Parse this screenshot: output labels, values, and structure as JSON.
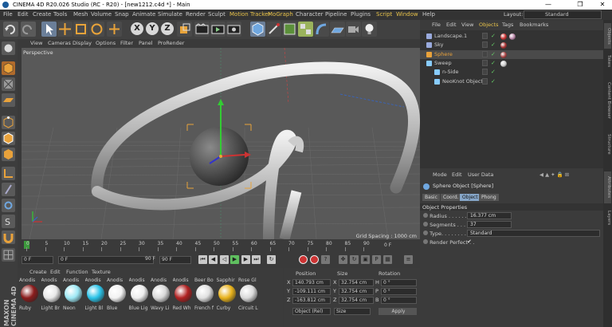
{
  "window": {
    "title": "CINEMA 4D R20.026 Studio (RC - R20) - [new1212.c4d *] - Main",
    "minimize": "—",
    "maximize": "❐",
    "close": "✕"
  },
  "menubar": {
    "items": [
      "File",
      "Edit",
      "Create",
      "Tools",
      "Mesh",
      "Volume",
      "Snap",
      "Animate",
      "Simulate",
      "Render",
      "Sculpt",
      "Motion Tracker",
      "MoGraph",
      "Character",
      "Pipeline",
      "Plugins",
      "Script",
      "Window",
      "Help"
    ],
    "highlighted": [
      "Motion Tracker",
      "Script"
    ],
    "layout_label": "Layout:",
    "layout_value": "Standard"
  },
  "toolbar": {
    "axes": [
      "X",
      "Y",
      "Z"
    ]
  },
  "viewport": {
    "menu": [
      "View",
      "Cameras",
      "Display",
      "Options",
      "Filter",
      "Panel",
      "ProRender"
    ],
    "camera_label": "Perspective",
    "grid_spacing": "Grid Spacing : 1000 cm"
  },
  "timeline": {
    "ticks": [
      "0",
      "5",
      "10",
      "15",
      "20",
      "25",
      "30",
      "35",
      "40",
      "45",
      "50",
      "55",
      "60",
      "65",
      "70",
      "75",
      "80",
      "85",
      "90"
    ],
    "end_frame": "0 F"
  },
  "transport": {
    "start_field": "0 F",
    "current_field": "0 F",
    "end_field": "90 F",
    "max_field": "90 F"
  },
  "materials": {
    "menu": [
      "Create",
      "Edit",
      "Function",
      "Texture"
    ],
    "items": [
      {
        "top": "Anodis",
        "name": "Ruby",
        "color": "#8a1c1c"
      },
      {
        "top": "Anodis",
        "name": "Light Br",
        "color": "#e8e8e8"
      },
      {
        "top": "Anodis",
        "name": "Neon",
        "color": "#9de8f5"
      },
      {
        "top": "Anodis",
        "name": "Light Bl",
        "color": "#2bc3e8"
      },
      {
        "top": "Anodis",
        "name": "Blue",
        "color": "#f2f2f2"
      },
      {
        "top": "Anodis",
        "name": "Blue Lig",
        "color": "#ededed"
      },
      {
        "top": "Anodis",
        "name": "Wavy Li",
        "color": "#d9d9d9"
      },
      {
        "top": "Anodis",
        "name": "Red Wh",
        "color": "#b02222"
      },
      {
        "top": "Beer Bo",
        "name": "French f",
        "color": "#e0e0e0"
      },
      {
        "top": "Sapphir",
        "name": "Curby",
        "color": "#e8b21b"
      },
      {
        "top": "Rose Gl",
        "name": "Circuit L",
        "color": "#dadada"
      }
    ]
  },
  "coordinates": {
    "headers": [
      "Position",
      "Size",
      "Rotation"
    ],
    "rows": [
      {
        "axis": "X",
        "pos": "140.793 cm",
        "sizeAxis": "X",
        "size": "32.754 cm",
        "rotAxis": "H",
        "rot": "0 °"
      },
      {
        "axis": "Y",
        "pos": "-109.111 cm",
        "sizeAxis": "Y",
        "size": "32.754 cm",
        "rotAxis": "P",
        "rot": "0 °"
      },
      {
        "axis": "Z",
        "pos": "-163.812 cm",
        "sizeAxis": "Z",
        "size": "32.754 cm",
        "rotAxis": "B",
        "rot": "0 °"
      }
    ],
    "mode_select": "Object (Rel)",
    "size_select": "Size",
    "apply": "Apply"
  },
  "object_manager": {
    "menu": [
      "File",
      "Edit",
      "View",
      "Objects",
      "Tags",
      "Bookmarks"
    ],
    "objects": [
      {
        "name": "Landscape.1",
        "color": "#9ad",
        "indent": 0,
        "selected": false
      },
      {
        "name": "Sky",
        "color": "#9ad",
        "indent": 0,
        "selected": false
      },
      {
        "name": "Sphere",
        "color": "#e9a23b",
        "indent": 0,
        "selected": true
      },
      {
        "name": "Sweep",
        "color": "#8cf",
        "indent": 0,
        "selected": false
      },
      {
        "name": "n-Side",
        "color": "#8cf",
        "indent": 1,
        "selected": false
      },
      {
        "name": "NeoKnot Object",
        "color": "#8cf",
        "indent": 1,
        "selected": false
      }
    ]
  },
  "attributes": {
    "menu": [
      "Mode",
      "Edit",
      "User Data"
    ],
    "object_title": "Sphere Object [Sphere]",
    "tabs": [
      "Basic",
      "Coord.",
      "Object",
      "Phong"
    ],
    "active_tab": "Object",
    "section": "Object Properties",
    "props": [
      {
        "label": "Radius . . . . . . .",
        "value": "16.377 cm"
      },
      {
        "label": "Segments . . . . .",
        "value": "37"
      },
      {
        "label": "Type. . . . . . . . . .",
        "value": "Standard"
      },
      {
        "label": "Render Perfect . .",
        "value": "✔"
      }
    ]
  },
  "right_tabs": [
    "Objects",
    "Takes",
    "Content Browser",
    "Structure",
    "Attributes",
    "Layers"
  ]
}
